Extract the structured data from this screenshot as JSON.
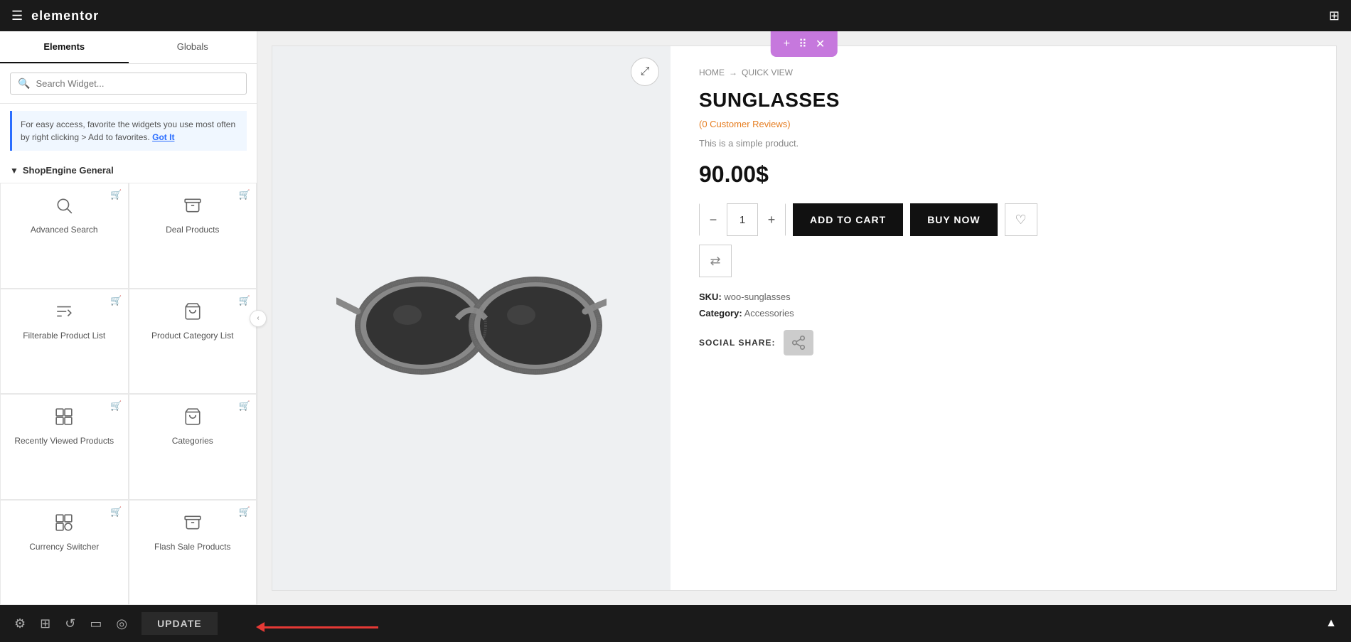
{
  "topbar": {
    "logo": "elementor",
    "hamburger_icon": "☰",
    "grid_icon": "⊞"
  },
  "sidebar": {
    "tabs": [
      {
        "id": "elements",
        "label": "Elements",
        "active": true
      },
      {
        "id": "globals",
        "label": "Globals",
        "active": false
      }
    ],
    "search_placeholder": "Search Widget...",
    "tip_text": "For easy access, favorite the widgets you use most often by right clicking > Add to favorites.",
    "tip_link": "Got It",
    "section_title": "ShopEngine General",
    "widgets": [
      {
        "id": "advanced-search",
        "label": "Advanced Search",
        "icon": "search"
      },
      {
        "id": "deal-products",
        "label": "Deal Products",
        "icon": "archive"
      },
      {
        "id": "filterable-product-list",
        "label": "Filterable Product List",
        "icon": "filter"
      },
      {
        "id": "product-category-list",
        "label": "Product Category List",
        "icon": "bag"
      },
      {
        "id": "recently-viewed-products",
        "label": "Recently Viewed Products",
        "icon": "gallery"
      },
      {
        "id": "categories",
        "label": "Categories",
        "icon": "bag2"
      },
      {
        "id": "currency-switcher",
        "label": "Currency Switcher",
        "icon": "gallery2"
      },
      {
        "id": "flash-sale-products",
        "label": "Flash Sale Products",
        "icon": "archive2"
      }
    ]
  },
  "toolbar": {
    "plus_label": "+",
    "grid_label": "⠿",
    "close_label": "✕"
  },
  "product": {
    "breadcrumb": {
      "home": "HOME",
      "separator": "→",
      "current": "QUICK VIEW"
    },
    "title": "SUNGLASSES",
    "reviews": "(0 Customer Reviews)",
    "description": "This is a simple product.",
    "price": "90.00$",
    "quantity": "1",
    "add_to_cart_label": "ADD TO CART",
    "buy_now_label": "BUY NOW",
    "sku_label": "SKU:",
    "sku_value": "woo-sunglasses",
    "category_label": "Category:",
    "category_value": "Accessories",
    "social_share_label": "SOCIAL SHARE:"
  },
  "bottombar": {
    "update_label": "UPDATE",
    "icons": [
      "settings",
      "layers",
      "history",
      "responsive",
      "eye"
    ]
  }
}
